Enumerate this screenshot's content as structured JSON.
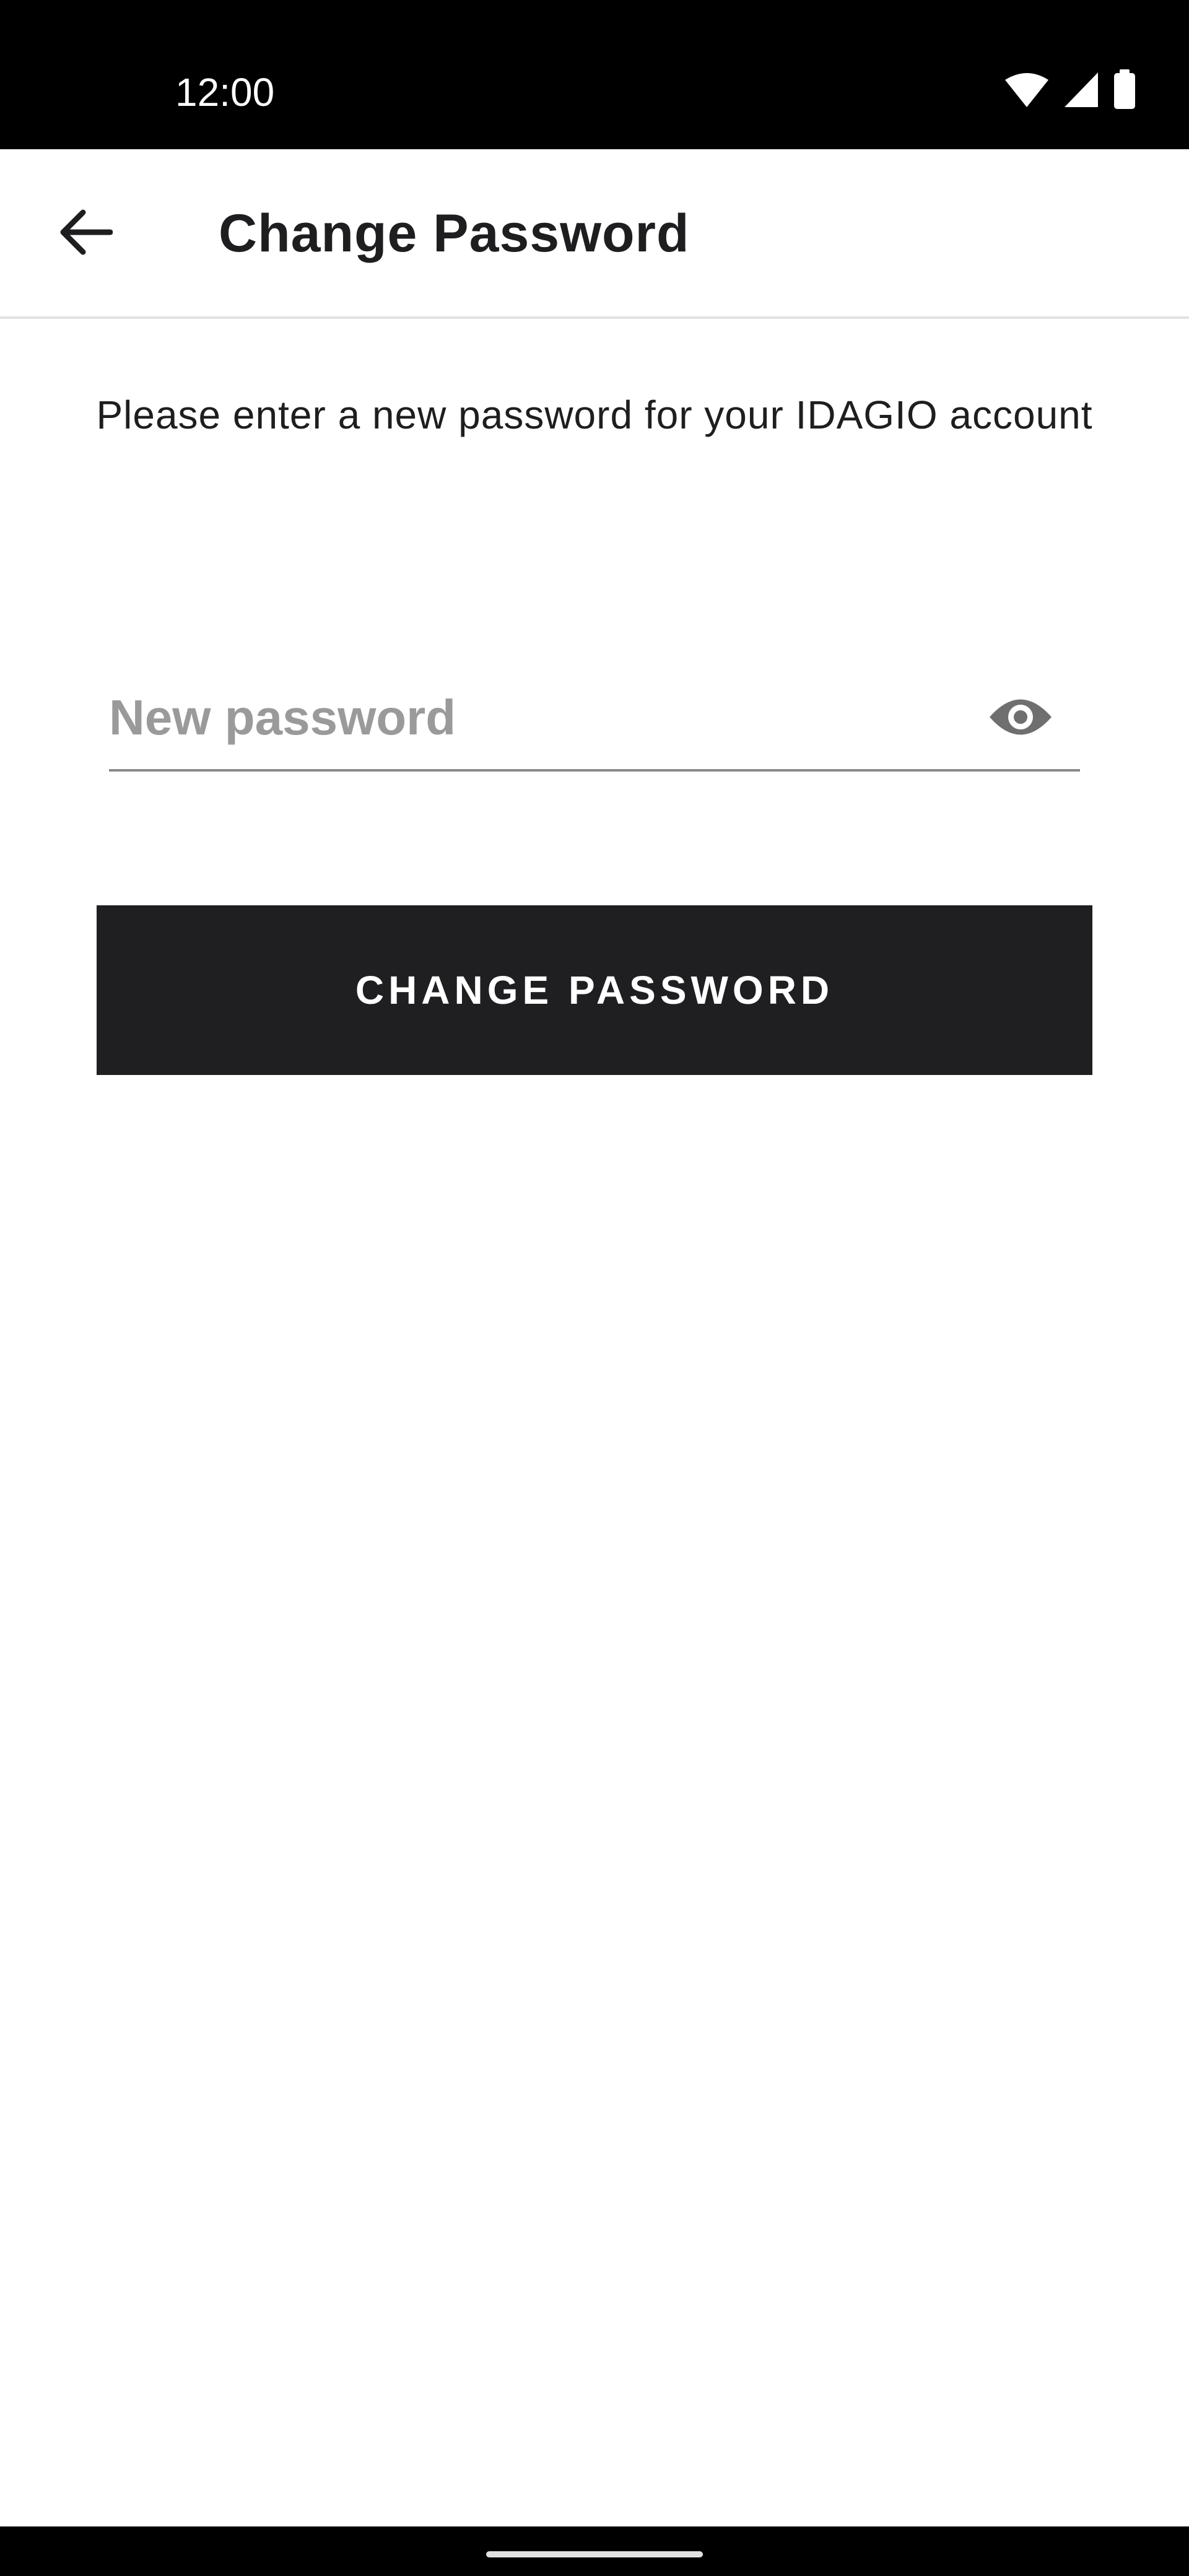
{
  "status_bar": {
    "time": "12:00",
    "icons": [
      "wifi-icon",
      "signal-icon",
      "battery-icon"
    ]
  },
  "app_bar": {
    "back_icon": "arrow-left-icon",
    "title": "Change Password"
  },
  "content": {
    "instruction": "Please enter a new password for your IDAGIO account",
    "password_field": {
      "placeholder": "New password",
      "value": "",
      "toggle_icon": "eye-icon"
    },
    "submit_label": "CHANGE PASSWORD"
  },
  "colors": {
    "primary_dark": "#1f1f22",
    "text": "#1e1e20",
    "placeholder": "#9a9a9a",
    "status_bar": "#000000"
  }
}
